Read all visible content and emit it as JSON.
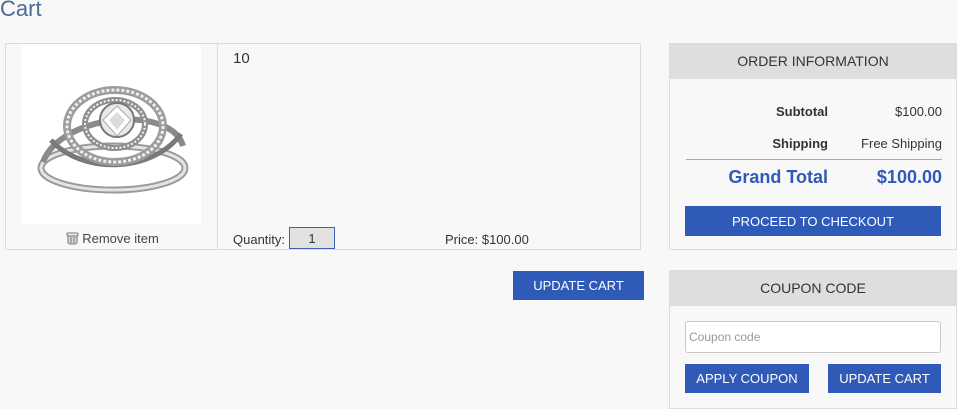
{
  "page": {
    "title": "Cart"
  },
  "cart": {
    "item": {
      "name": "10",
      "remove_label": "Remove item",
      "quantity_label": "Quantity:",
      "quantity_value": "1",
      "price_text": "Price: $100.00"
    },
    "update_cart_label": "UPDATE CART"
  },
  "order": {
    "header": "ORDER INFORMATION",
    "subtotal_label": "Subtotal",
    "subtotal_value": "$100.00",
    "shipping_label": "Shipping",
    "shipping_value": "Free Shipping",
    "grand_total_label": "Grand Total",
    "grand_total_value": "$100.00",
    "checkout_label": "PROCEED TO CHECKOUT"
  },
  "coupon": {
    "header": "COUPON CODE",
    "placeholder": "Coupon code",
    "apply_label": "APPLY COUPON",
    "update_cart_label": "UPDATE CART"
  },
  "colors": {
    "accent": "#2f5ab8",
    "title": "#4a6a98",
    "panel_header": "#dedede"
  }
}
